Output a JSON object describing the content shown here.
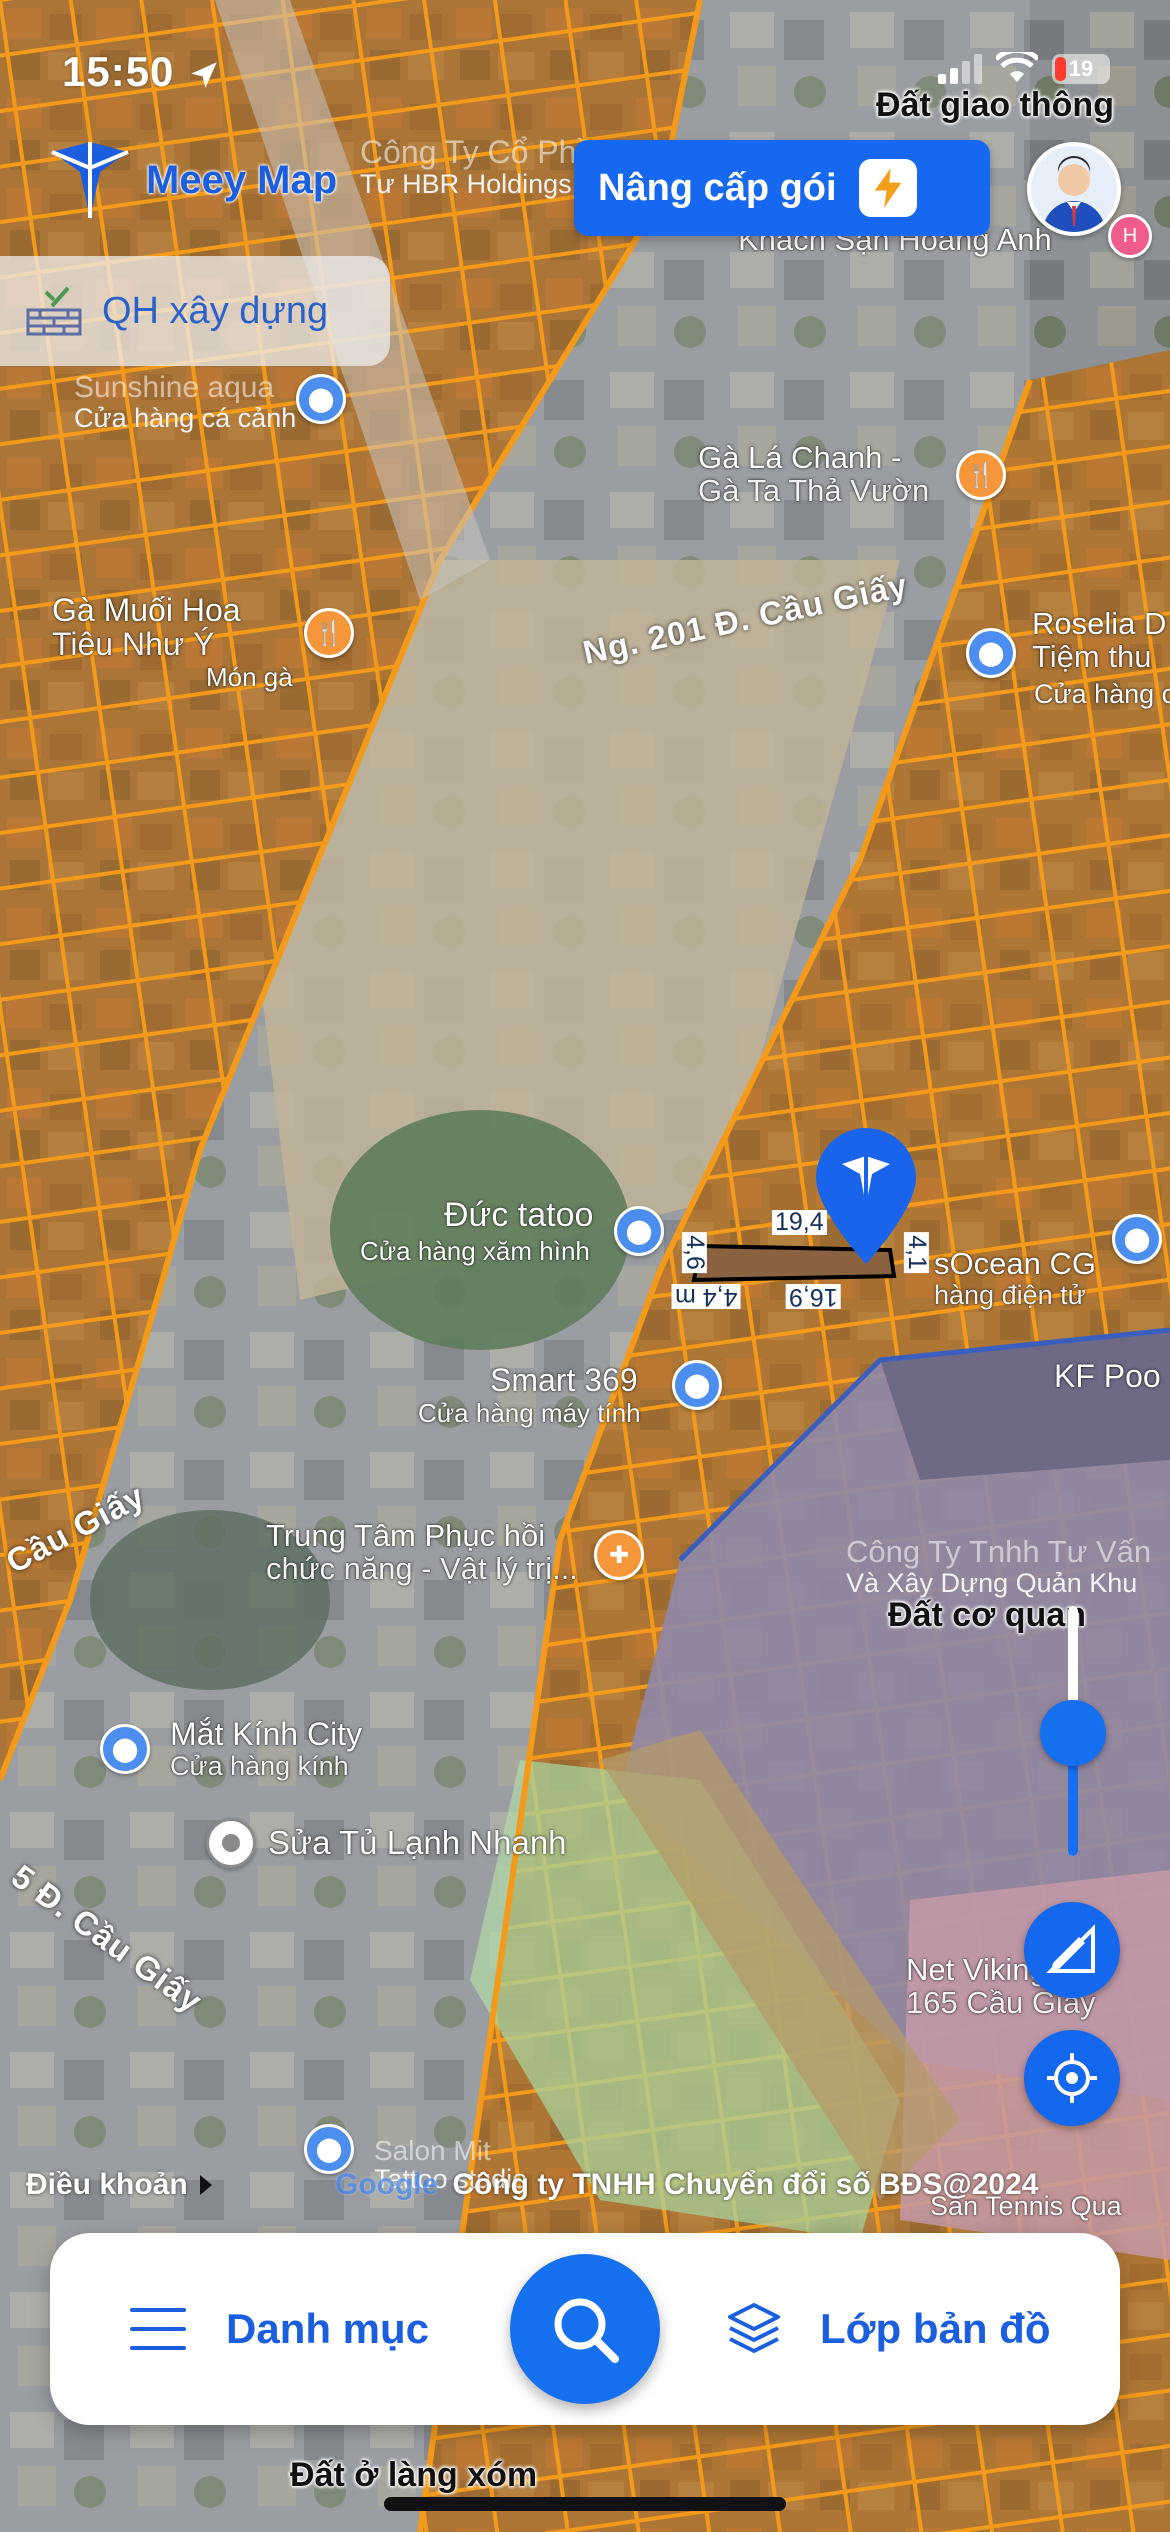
{
  "status_bar": {
    "time": "15:50",
    "battery": "19"
  },
  "app": {
    "name": "Meey Map",
    "brand_color": "#1768f1",
    "upgrade_label": "Nâng cấp gói",
    "layer_chip_label": "QH xây dựng"
  },
  "map": {
    "zones": [
      {
        "label": "Đất giao thông"
      },
      {
        "label": "Đất cơ quan"
      },
      {
        "label": "Đất ở làng xóm"
      }
    ],
    "roads": [
      {
        "label": "Ng. 201 Đ. Cầu Giấy"
      },
      {
        "label": "Cầu Giấy"
      },
      {
        "label": "5 Đ. Cầu Giấy"
      }
    ],
    "places": [
      {
        "name": "Công Ty Cổ Phần",
        "sub": "Tư HBR Holdings"
      },
      {
        "name": "Khách Sạn Hoàng Anh",
        "sub": ""
      },
      {
        "name": "Sunshine aqua",
        "sub": "Cửa hàng cá cảnh"
      },
      {
        "name": "Gà Lá Chanh -",
        "sub": "Gà Ta Thả Vườn"
      },
      {
        "name": "Gà Muối Hoa",
        "sub": "Tiêu Như Ý"
      },
      {
        "name": "Món gà",
        "sub": ""
      },
      {
        "name": "Roselia D",
        "sub": "Tiệm thu"
      },
      {
        "name": "Cửa hàng c",
        "sub": ""
      },
      {
        "name": "Đức tatoo",
        "sub": "Cửa hàng xăm hình"
      },
      {
        "name": "sOcean CG",
        "sub": "hàng điện tử"
      },
      {
        "name": "KF Poo",
        "sub": ""
      },
      {
        "name": "Smart 369",
        "sub": "Cửa hàng máy tính"
      },
      {
        "name": "Trung Tâm Phục hồi",
        "sub": "chức năng - Vật lý trị..."
      },
      {
        "name": "Công Ty Tnhh Tư Vấn",
        "sub": "Và Xây Dựng Quản Khu"
      },
      {
        "name": "Mắt Kính City",
        "sub": "Cửa hàng kính"
      },
      {
        "name": "Sửa Tủ Lạnh Nhanh",
        "sub": ""
      },
      {
        "name": "Net Viking",
        "sub": "165 Cầu Giấy"
      },
      {
        "name": "Salon Mit",
        "sub": "Tattoo studio"
      },
      {
        "name": "Sân Tennis Qua",
        "sub": ""
      }
    ],
    "parcel_dimensions": [
      "19,4",
      "4,6",
      "4,1",
      "16,9",
      "4,4 m"
    ]
  },
  "footer": {
    "terms_label": "Điều khoản",
    "google_label": "Google",
    "copyright": "Công ty TNHH Chuyển đổi số BĐS@2024"
  },
  "bottom_nav": {
    "menu_label": "Danh mục",
    "layers_label": "Lớp bản đồ"
  },
  "icons": {
    "logo": "meey-logo-icon",
    "upgrade": "lightning-icon",
    "avatar": "user-avatar",
    "chip": "building-plan-icon",
    "measure": "ruler-pencil-icon",
    "locate": "locate-icon",
    "search": "search-icon",
    "menu": "menu-icon",
    "layers": "layers-icon"
  }
}
